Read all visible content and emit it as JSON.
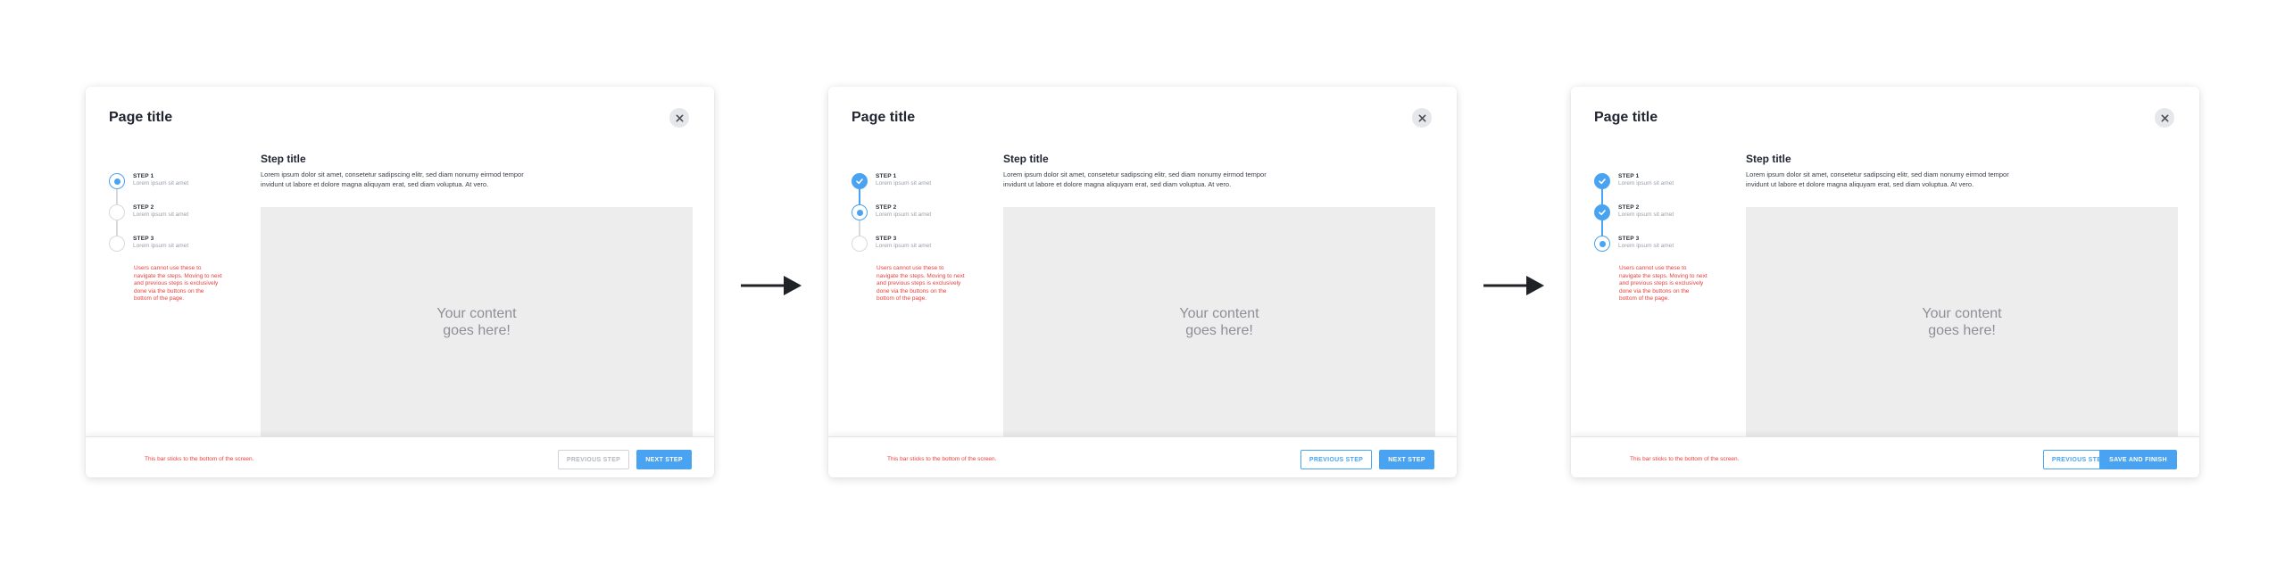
{
  "colors": {
    "accent": "#4aa3f0",
    "note": "#e8413c",
    "content_bg": "#ededed"
  },
  "icons": {
    "close": "close-icon",
    "check": "check-icon",
    "arrow": "arrow-right-icon"
  },
  "panels": [
    {
      "page_title": "Page title",
      "steps": [
        {
          "label": "STEP 1",
          "sub": "Lorem ipsum sit amet",
          "state": "current"
        },
        {
          "label": "STEP 2",
          "sub": "Lorem ipsum sit amet",
          "state": "upcoming"
        },
        {
          "label": "STEP 3",
          "sub": "Lorem ipsum sit amet",
          "state": "upcoming"
        }
      ],
      "note": "Users cannot use these to navigate the steps. Moving to next and previous steps is exclusively done via the buttons on the bottom of the page.",
      "step_title": "Step title",
      "step_desc": "Lorem ipsum dolor sit amet, consetetur sadipscing elitr, sed diam nonumy eirmod tempor invidunt ut labore et dolore magna aliquyam erat, sed diam voluptua. At vero.",
      "content_placeholder": "Your content\ngoes here!",
      "bar_note": "This bar sticks to the bottom of the screen.",
      "prev_label": "PREVIOUS STEP",
      "prev_enabled": false,
      "next_label": "NEXT STEP"
    },
    {
      "page_title": "Page title",
      "steps": [
        {
          "label": "STEP 1",
          "sub": "Lorem ipsum sit amet",
          "state": "done"
        },
        {
          "label": "STEP 2",
          "sub": "Lorem ipsum sit amet",
          "state": "current"
        },
        {
          "label": "STEP 3",
          "sub": "Lorem ipsum sit amet",
          "state": "upcoming"
        }
      ],
      "note": "Users cannot use these to navigate the steps. Moving to next and previous steps is exclusively done via the buttons on the bottom of the page.",
      "step_title": "Step title",
      "step_desc": "Lorem ipsum dolor sit amet, consetetur sadipscing elitr, sed diam nonumy eirmod tempor invidunt ut labore et dolore magna aliquyam erat, sed diam voluptua. At vero.",
      "content_placeholder": "Your content\ngoes here!",
      "bar_note": "This bar sticks to the bottom of the screen.",
      "prev_label": "PREVIOUS STEP",
      "prev_enabled": true,
      "next_label": "NEXT STEP"
    },
    {
      "page_title": "Page title",
      "steps": [
        {
          "label": "STEP 1",
          "sub": "Lorem ipsum sit amet",
          "state": "done"
        },
        {
          "label": "STEP 2",
          "sub": "Lorem ipsum sit amet",
          "state": "done"
        },
        {
          "label": "STEP 3",
          "sub": "Lorem ipsum sit amet",
          "state": "current"
        }
      ],
      "note": "Users cannot use these to navigate the steps. Moving to next and previous steps is exclusively done via the buttons on the bottom of the page.",
      "step_title": "Step title",
      "step_desc": "Lorem ipsum dolor sit amet, consetetur sadipscing elitr, sed diam nonumy eirmod tempor invidunt ut labore et dolore magna aliquyam erat, sed diam voluptua. At vero.",
      "content_placeholder": "Your content\ngoes here!",
      "bar_note": "This bar sticks to the bottom of the screen.",
      "prev_label": "PREVIOUS STEP",
      "prev_enabled": true,
      "next_label": "SAVE AND FINISH"
    }
  ]
}
